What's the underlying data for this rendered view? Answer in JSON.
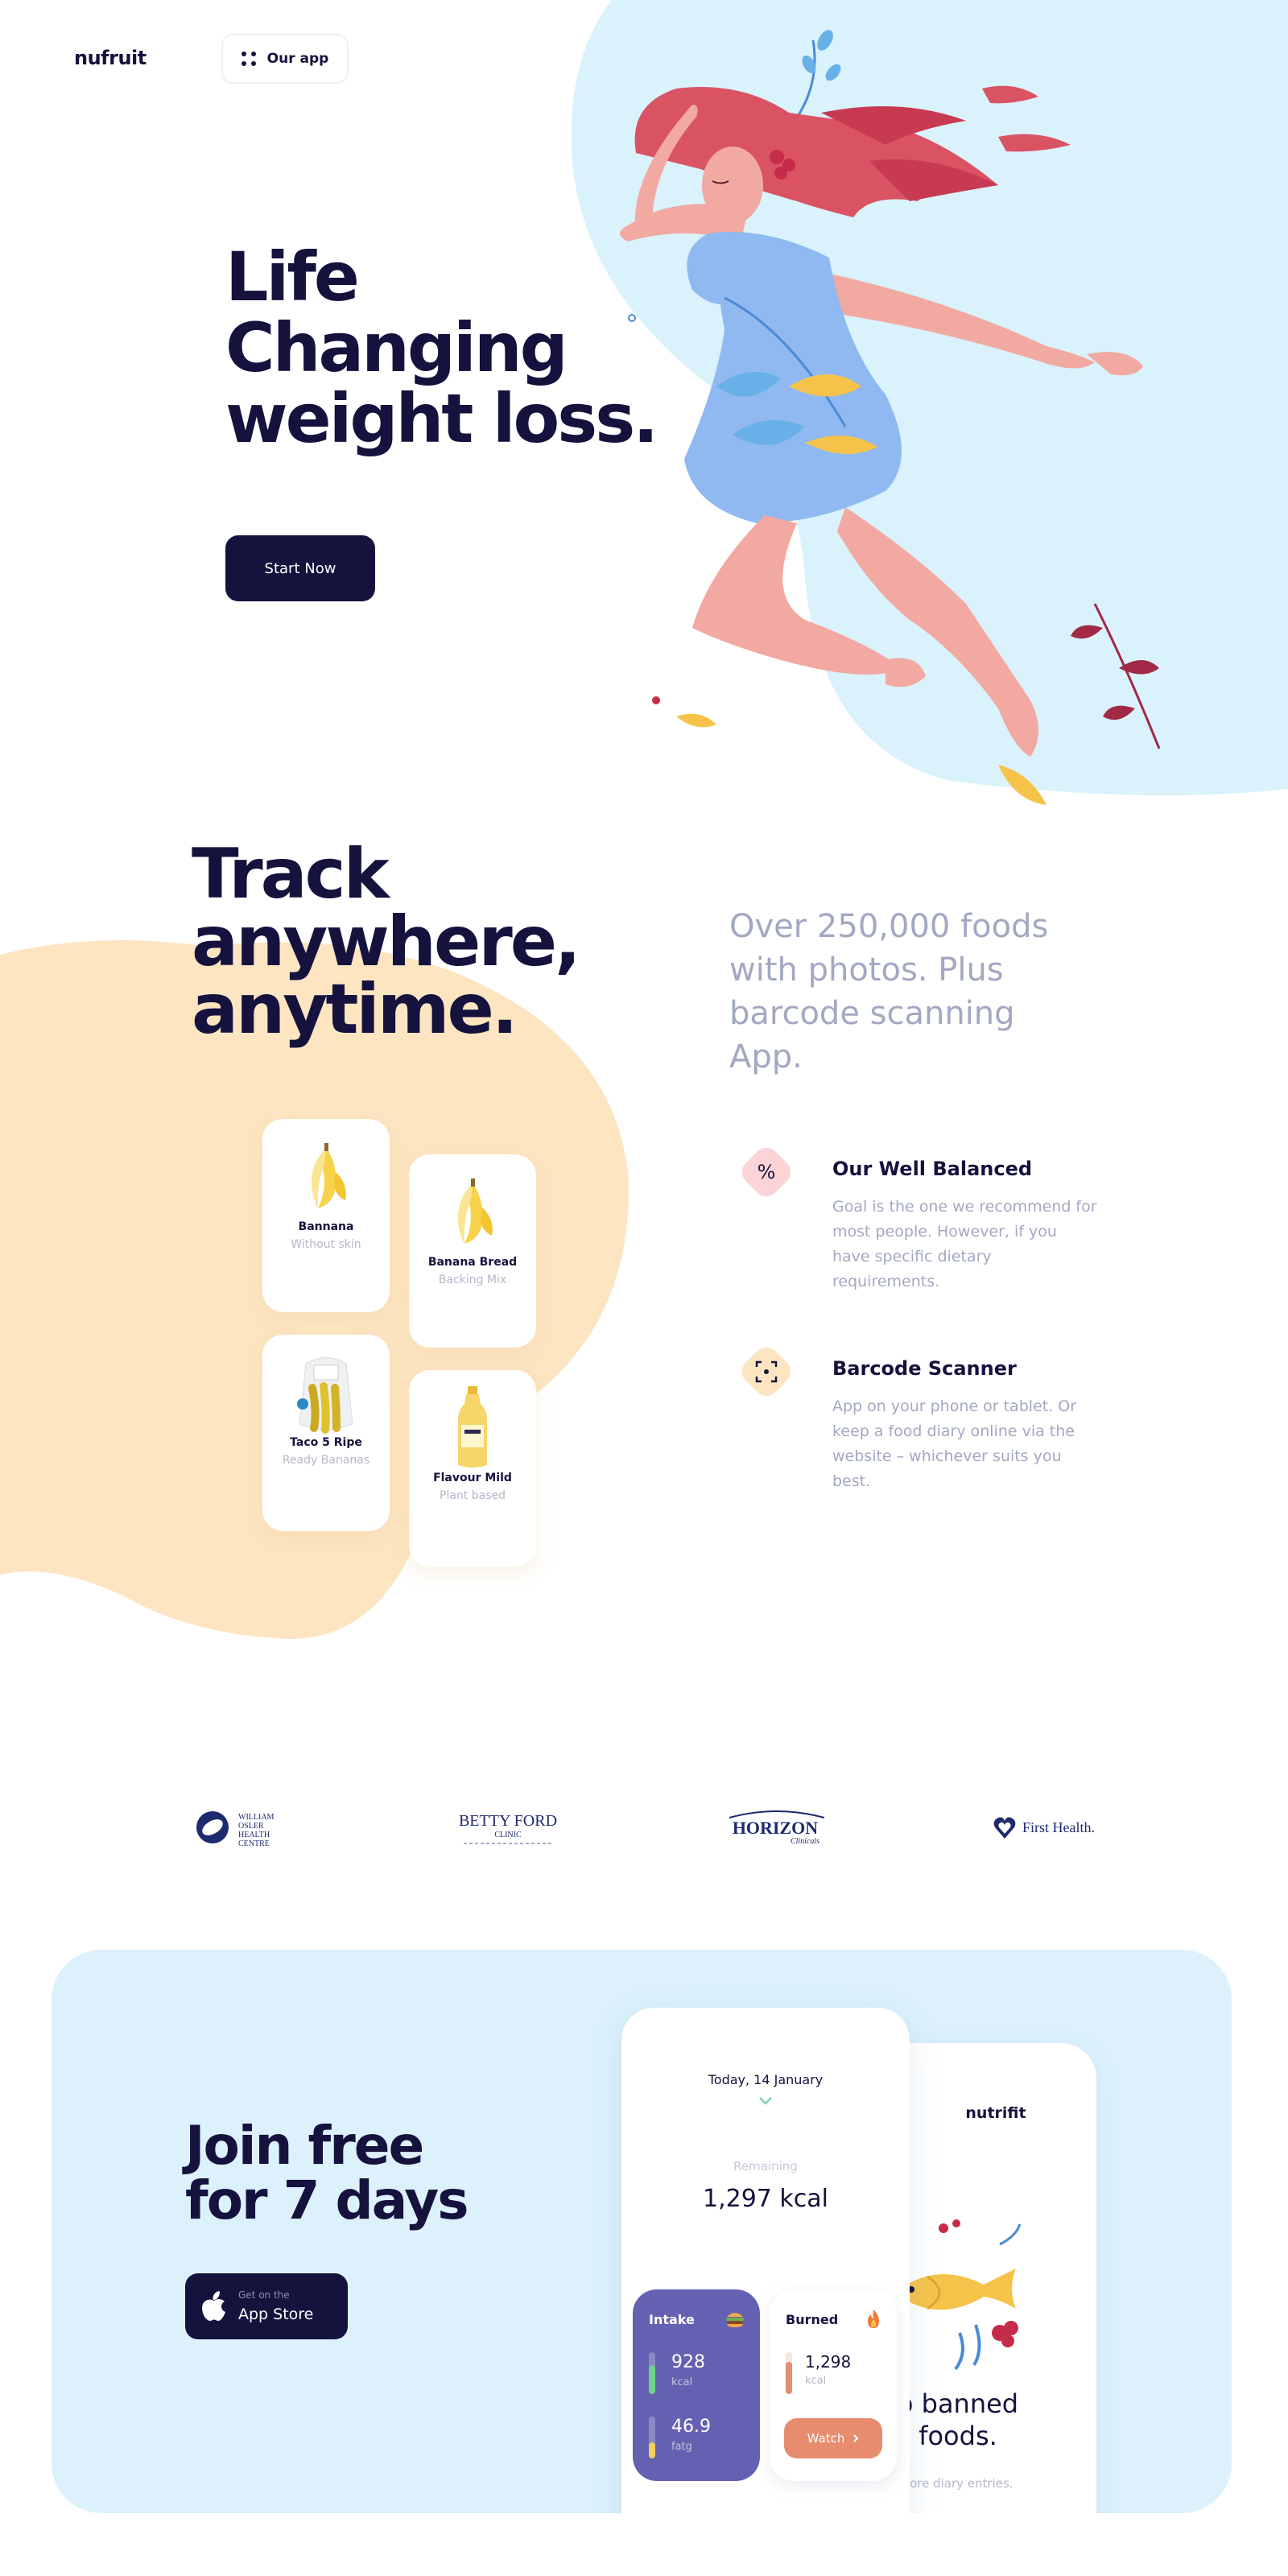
{
  "header": {
    "logo": "nufruit",
    "app_button": "Our app"
  },
  "hero": {
    "title_lines": [
      "Life",
      "Changing",
      "weight loss."
    ],
    "cta": "Start Now"
  },
  "track": {
    "title_lines": [
      "Track",
      "anywhere,",
      "anytime."
    ],
    "subtitle": "Over 250,000 foods with photos. Plus barcode scanning App.",
    "foods": [
      {
        "name": "Bannana",
        "sub": "Without skin",
        "icon": "banana-icon"
      },
      {
        "name": "Banana Bread",
        "sub": "Backing Mix",
        "icon": "banana-icon"
      },
      {
        "name": "Taco 5 Ripe",
        "sub": "Ready Bananas",
        "icon": "banana-bag-icon"
      },
      {
        "name": "Flavour Mild",
        "sub": "Plant based",
        "icon": "milk-bottle-icon"
      }
    ],
    "features": [
      {
        "title": "Our Well Balanced",
        "desc": "Goal is the one we recommend for most people. However, if you have specific dietary requirements.",
        "icon": "percent-icon",
        "symbol": "%"
      },
      {
        "title": "Barcode Scanner",
        "desc": "App on your phone or tablet. Or keep a food diary online via the website – whichever suits you best.",
        "icon": "scan-icon"
      }
    ]
  },
  "partners": [
    {
      "name": "William Osler Health Centre",
      "lines": [
        "WILLIAM",
        "OSLER",
        "HEALTH",
        "CENTRE"
      ]
    },
    {
      "name": "Betty Ford Clinic",
      "lines": [
        "BETTY FORD",
        "CLINIC"
      ]
    },
    {
      "name": "Horizon Clinicals",
      "lines": [
        "HORIZON",
        "Clinicals"
      ]
    },
    {
      "name": "First Health",
      "lines": [
        "First Health."
      ]
    }
  ],
  "join": {
    "title_lines": [
      "Join free",
      "for 7 days"
    ],
    "store_small": "Get on the",
    "store_big": "App Store",
    "phone": {
      "date": "Today, 14 January",
      "remaining_label": "Remaining",
      "remaining_value": "1,297 kcal",
      "intake": {
        "title": "Intake",
        "kcal_value": "928",
        "kcal_unit": "kcal",
        "fat_value": "46.9",
        "fat_unit": "fatg"
      },
      "burned": {
        "title": "Burned",
        "kcal_value": "1,298",
        "kcal_unit": "kcal",
        "button": "Watch"
      }
    },
    "phone_back": {
      "brand": "nutrifit",
      "text_lines": [
        "o banned",
        "foods."
      ],
      "small": "more diary entries."
    }
  },
  "colors": {
    "navy": "#15123e",
    "sky": "#dcf1fc",
    "peach": "#fde5c2",
    "muted": "#a3a8c2",
    "intake": "#6561b2",
    "watch": "#e78c6e"
  }
}
